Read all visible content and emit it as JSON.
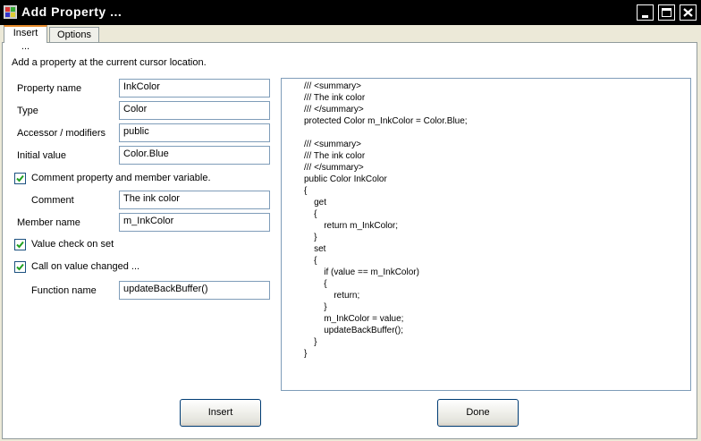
{
  "window": {
    "title": "Add Property ...",
    "buttons": {
      "minimize": "minimize-icon",
      "maximize": "maximize-icon",
      "close": "close-icon"
    }
  },
  "tabs": [
    {
      "label": "Insert ...",
      "active": true
    },
    {
      "label": "Options ...",
      "active": false
    }
  ],
  "intro": "Add a property at the current cursor location.",
  "form": {
    "property_name": {
      "label": "Property name",
      "value": "InkColor"
    },
    "type": {
      "label": "Type",
      "value": "Color"
    },
    "accessor": {
      "label": "Accessor / modifiers",
      "value": "public"
    },
    "initial_value": {
      "label": "Initial value",
      "value": "Color.Blue"
    },
    "comment_check": {
      "label": "Comment property and member variable.",
      "checked": true
    },
    "comment": {
      "label": "Comment",
      "value": "The ink color"
    },
    "member_name": {
      "label": "Member  name",
      "value": "m_InkColor"
    },
    "value_check": {
      "label": "Value check on set",
      "checked": true
    },
    "call_changed": {
      "label": "Call on value changed ...",
      "checked": true
    },
    "function_name": {
      "label": "Function name",
      "value": "updateBackBuffer()"
    }
  },
  "code": [
    "/// <summary>",
    "/// The ink color",
    "/// </summary>",
    "protected Color m_InkColor = Color.Blue;",
    "",
    "/// <summary>",
    "/// The ink color",
    "/// </summary>",
    "public Color InkColor",
    "{",
    "    get",
    "    {",
    "        return m_InkColor;",
    "    }",
    "    set",
    "    {",
    "        if (value == m_InkColor)",
    "        {",
    "            return;",
    "        }",
    "        m_InkColor = value;",
    "        updateBackBuffer();",
    "    }",
    "}"
  ],
  "actions": {
    "insert_label": "Insert",
    "done_label": "Done"
  },
  "colors": {
    "titlebar": "#000000",
    "face": "#ece9d8",
    "field_border": "#7f9db9",
    "tab_accent": "#e68b2c"
  }
}
